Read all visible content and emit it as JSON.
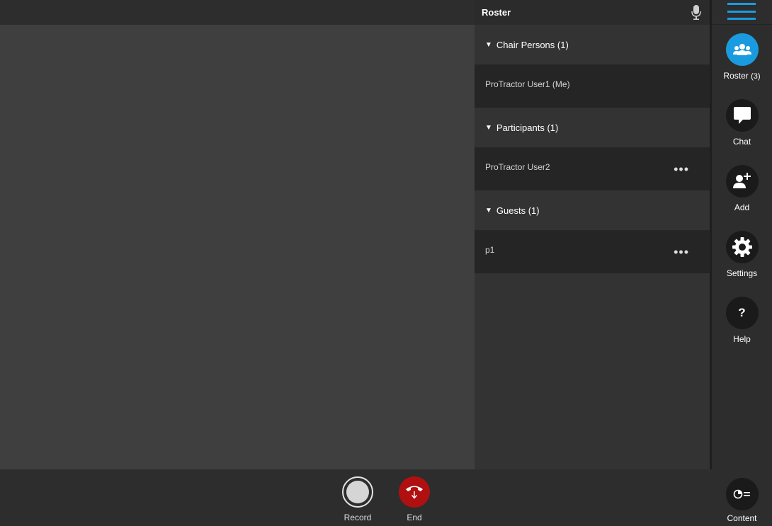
{
  "roster": {
    "title": "Roster",
    "groups": [
      {
        "label": "Chair Persons (1)",
        "members": [
          {
            "name": "ProTractor User1 (Me)",
            "has_menu": false
          }
        ]
      },
      {
        "label": "Participants (1)",
        "members": [
          {
            "name": "ProTractor User2",
            "has_menu": true
          }
        ]
      },
      {
        "label": "Guests (1)",
        "members": [
          {
            "name": "p1",
            "has_menu": true
          }
        ]
      }
    ],
    "more_glyph": "•••",
    "caret_glyph": "▼"
  },
  "sidebar": {
    "menu_icon": "hamburger-icon",
    "items": [
      {
        "label": "Roster",
        "count": "(3)",
        "icon": "people-icon",
        "active": true
      },
      {
        "label": "Chat",
        "icon": "chat-bubble-icon"
      },
      {
        "label": "Add",
        "icon": "add-user-icon"
      },
      {
        "label": "Settings",
        "icon": "gear-icon"
      },
      {
        "label": "Help",
        "icon": "question-icon",
        "glyph": "?"
      }
    ],
    "content": {
      "label": "Content",
      "icon": "content-share-icon"
    }
  },
  "controls": {
    "record": {
      "label": "Record"
    },
    "end": {
      "label": "End"
    }
  },
  "colors": {
    "accent": "#1a9be0",
    "end": "#b01010",
    "video_bg": "#3f3f3f",
    "panel_bg": "#333333"
  }
}
